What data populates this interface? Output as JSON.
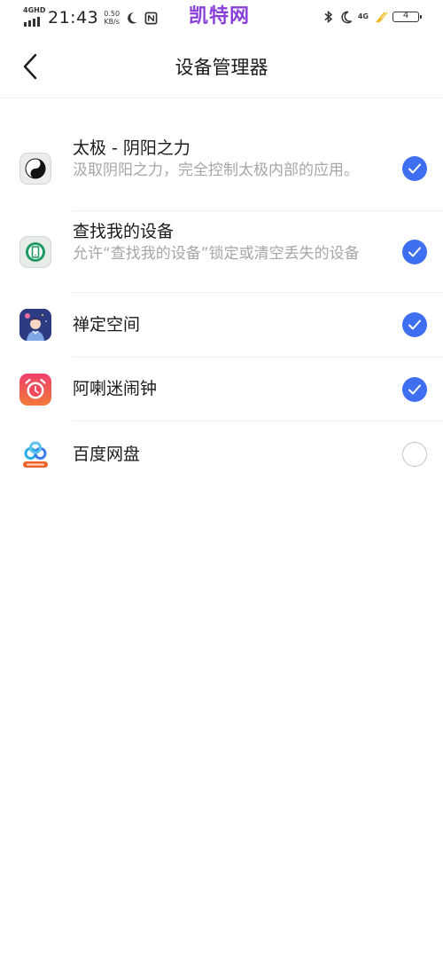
{
  "status_bar": {
    "network_label": "4GHD",
    "time": "21:43",
    "speed_value": "0.50",
    "speed_unit": "KB/s",
    "carrier_brand": "凯特网",
    "network_right": "4G",
    "battery_level": "4",
    "icons": [
      "signal-icon",
      "moon-icon",
      "nfc-icon",
      "bluetooth-icon",
      "moon-icon",
      "charging-icon",
      "battery-icon"
    ]
  },
  "header": {
    "title": "设备管理器",
    "back_icon": "chevron-left-icon"
  },
  "accent_color": "#3e6ff0",
  "apps": [
    {
      "name": "太极 - 阴阳之力",
      "description": "汲取阴阳之力，完全控制太极内部的应用。",
      "icon": "taichi-icon",
      "enabled": true
    },
    {
      "name": "查找我的设备",
      "description": "允许“查找我的设备”锁定或清空丢失的设备",
      "icon": "find-device-icon",
      "enabled": true
    },
    {
      "name": "禅定空间",
      "description": "",
      "icon": "zen-space-icon",
      "enabled": true
    },
    {
      "name": "阿喇迷闹钟",
      "description": "",
      "icon": "alarm-clock-icon",
      "enabled": true
    },
    {
      "name": "百度网盘",
      "description": "",
      "icon": "baidu-netdisk-icon",
      "enabled": false
    }
  ]
}
